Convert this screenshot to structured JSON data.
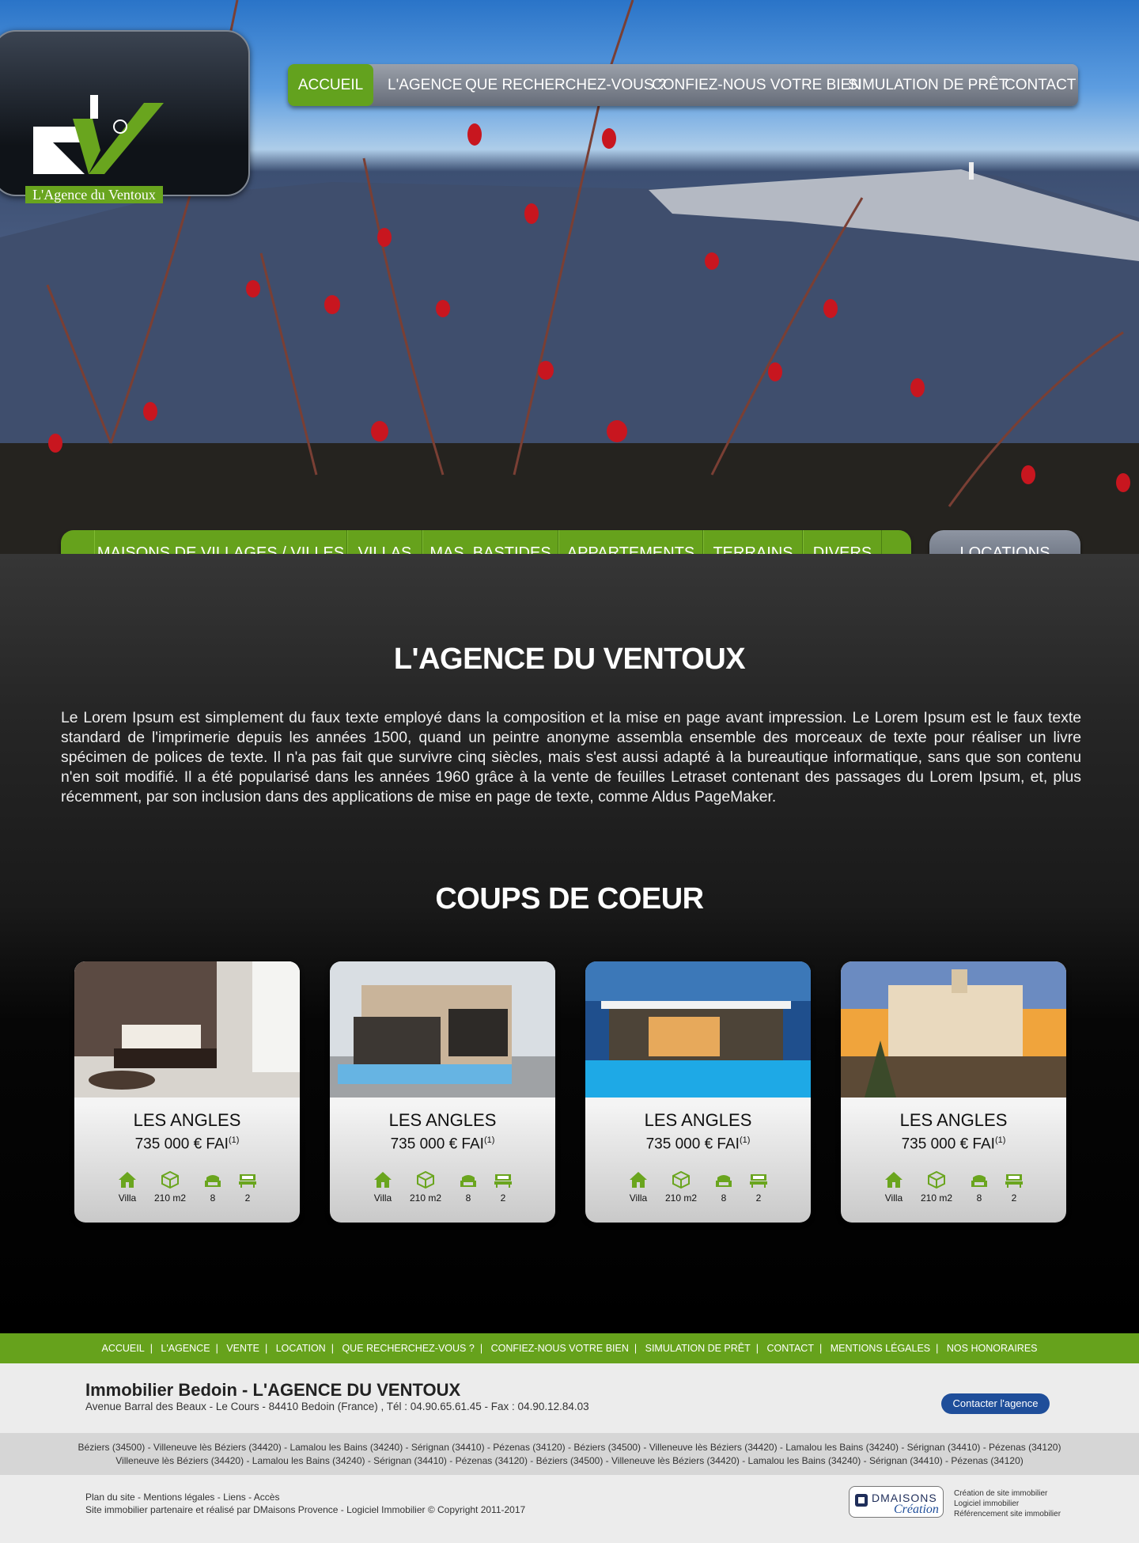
{
  "brand": {
    "logo_text": "L'Agence du Ventoux",
    "accent_green": "#66a21c",
    "nav_grey": "#7d838e",
    "button_blue": "#1f4e9a"
  },
  "nav": {
    "items": [
      "ACCUEIL",
      "L'AGENCE",
      "QUE RECHERCHEZ-VOUS ?",
      "CONFIEZ-NOUS VOTRE BIEN",
      "SIMULATION DE PRÊT",
      "CONTACT"
    ],
    "active": "ACCUEIL"
  },
  "categories": {
    "items": [
      "MAISONS DE VILLAGES / VILLES",
      "VILLAS",
      "MAS, BASTIDES",
      "APPARTEMENTS",
      "TERRAINS",
      "DIVERS"
    ],
    "locations_label": "LOCATIONS"
  },
  "intro": {
    "title": "L'AGENCE DU VENTOUX",
    "text": "Le Lorem Ipsum est simplement du faux texte employé dans la composition et la mise en page avant impression. Le Lorem Ipsum est le faux texte standard de l'imprimerie depuis les années 1500, quand un peintre anonyme assembla ensemble des morceaux de texte pour réaliser un livre spécimen de polices de texte. Il n'a pas fait que survivre cinq siècles, mais s'est aussi adapté à la bureautique informatique, sans que son contenu n'en soit modifié. Il a été popularisé dans les années 1960 grâce à la vente de feuilles Letraset contenant des passages du Lorem Ipsum, et, plus récemment, par son inclusion dans des applications de mise en page de texte, comme Aldus PageMaker."
  },
  "coups_de_coeur": {
    "title": "COUPS DE COEUR",
    "cards": [
      {
        "city": "LES ANGLES",
        "price": "735 000 € FAI",
        "note": "(1)",
        "type": "Villa",
        "surface": "210 m2",
        "rooms": "8",
        "bedrooms": "2"
      },
      {
        "city": "LES ANGLES",
        "price": "735 000 € FAI",
        "note": "(1)",
        "type": "Villa",
        "surface": "210 m2",
        "rooms": "8",
        "bedrooms": "2"
      },
      {
        "city": "LES ANGLES",
        "price": "735 000 € FAI",
        "note": "(1)",
        "type": "Villa",
        "surface": "210 m2",
        "rooms": "8",
        "bedrooms": "2"
      },
      {
        "city": "LES ANGLES",
        "price": "735 000 € FAI",
        "note": "(1)",
        "type": "Villa",
        "surface": "210 m2",
        "rooms": "8",
        "bedrooms": "2"
      }
    ]
  },
  "footer_nav": [
    "ACCUEIL",
    "L'AGENCE",
    "VENTE",
    "LOCATION",
    "QUE RECHERCHEZ-VOUS ?",
    "CONFIEZ-NOUS VOTRE BIEN",
    "SIMULATION DE PRÊT",
    "CONTACT",
    "MENTIONS LÉGALES",
    "NOS HONORAIRES"
  ],
  "footer": {
    "agency": "Immobilier Bedoin - L'AGENCE DU VENTOUX",
    "address": "Avenue Barral des Beaux - Le Cours - 84410 Bedoin (France) , Tél : 04.90.65.61.45 - Fax : 04.90.12.84.03",
    "contact_button": "Contacter l'agence",
    "towns_line1": "Béziers (34500) - Villeneuve lès Béziers (34420) - Lamalou les Bains (34240) - Sérignan (34410) - Pézenas (34120) - Béziers (34500) - Villeneuve lès Béziers (34420) - Lamalou les Bains (34240) - Sérignan (34410) - Pézenas (34120)",
    "towns_line2": "Villeneuve lès Béziers (34420) - Lamalou les Bains (34240) - Sérignan (34410) - Pézenas (34120) - Béziers (34500) - Villeneuve lès Béziers (34420) - Lamalou les Bains (34240) - Sérignan (34410) - Pézenas (34120)",
    "links": "Plan du site - Mentions légales - Liens - Accès",
    "credit": "Site immobilier partenaire et réalisé par DMaisons Provence - Logiciel Immobilier © Copyright 2011-2017",
    "dmaisons_name": "DMAISONS",
    "dmaisons_sub": "Création",
    "dmaisons_links": [
      "Création de site immobilier",
      "Logiciel immobilier",
      "Référencement site immobilier"
    ]
  }
}
